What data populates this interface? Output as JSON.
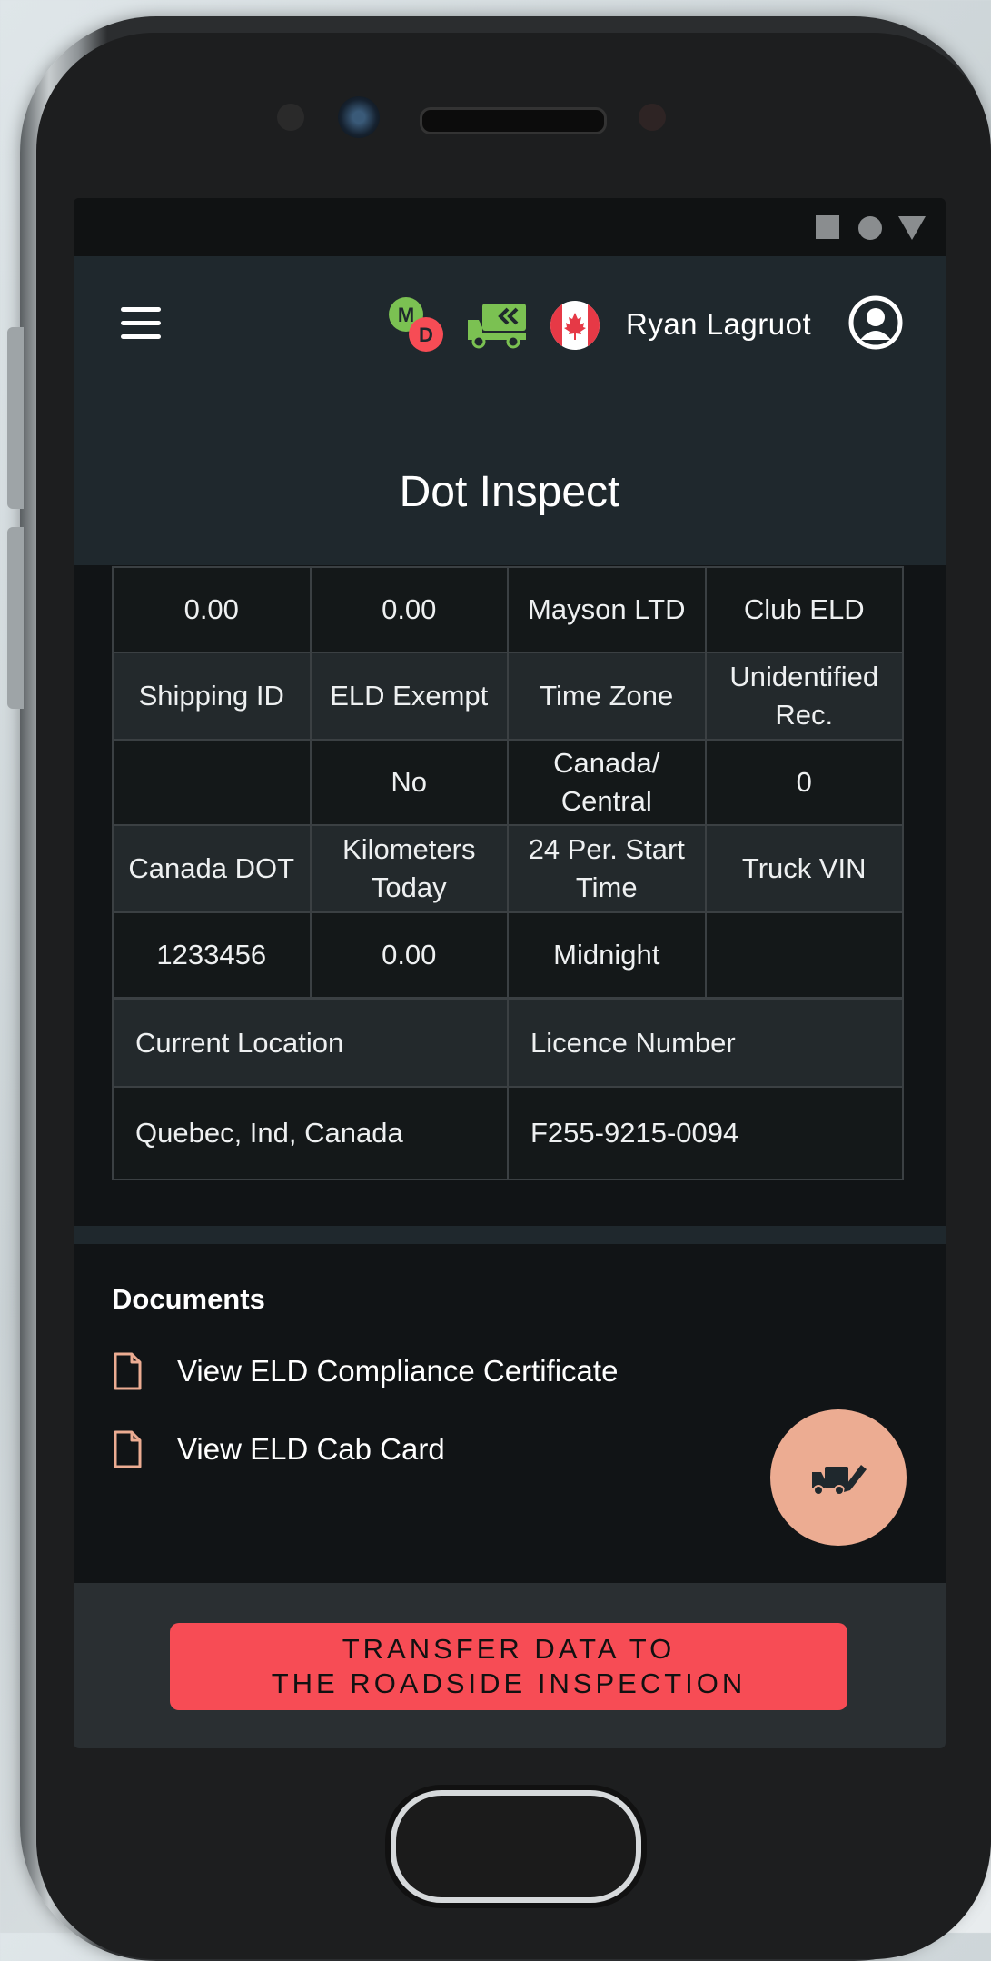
{
  "header": {
    "user_name": "Ryan Lagruot",
    "page_title": "Dot Inspect",
    "icons": [
      "menu-icon",
      "md-logo-icon",
      "truck-icon",
      "canada-flag-icon",
      "user-avatar-icon"
    ]
  },
  "status_bar": {
    "icons": [
      "square-icon",
      "circle-icon",
      "triangle-icon"
    ]
  },
  "inspection_table": {
    "rows": [
      {
        "type": "val",
        "cells": [
          "0.00",
          "0.00",
          "Mayson LTD",
          "Club ELD"
        ]
      },
      {
        "type": "hdr",
        "cells": [
          "Shipping ID",
          "ELD Exempt",
          "Time Zone",
          "Unidentified Rec."
        ]
      },
      {
        "type": "val",
        "cells": [
          "",
          "No",
          "Canada/ Central",
          "0"
        ]
      },
      {
        "type": "hdr",
        "cells": [
          "Canada DOT",
          "Kilometers Today",
          "24 Per. Start Time",
          "Truck VIN"
        ]
      },
      {
        "type": "val",
        "cells": [
          "1233456",
          "0.00",
          "Midnight",
          ""
        ]
      }
    ],
    "location_header": [
      "Current Location",
      "Licence Number"
    ],
    "location_values": [
      "Quebec, Ind, Canada",
      "F255-9215-0094"
    ]
  },
  "documents": {
    "title": "Documents",
    "items": [
      {
        "label": "View ELD Compliance Certificate",
        "icon": "document-icon"
      },
      {
        "label": "View ELD Cab Card",
        "icon": "document-icon"
      }
    ]
  },
  "fab": {
    "icon": "truck-edit-icon"
  },
  "footer": {
    "transfer_label": "TRANSFER DATA TO\nTHE ROADSIDE INSPECTION"
  },
  "colors": {
    "header_bg": "#1f282d",
    "screen_bg": "#111416",
    "accent_red": "#f74c55",
    "fab_bg": "#ecac92",
    "doc_icon": "#ecac92"
  }
}
